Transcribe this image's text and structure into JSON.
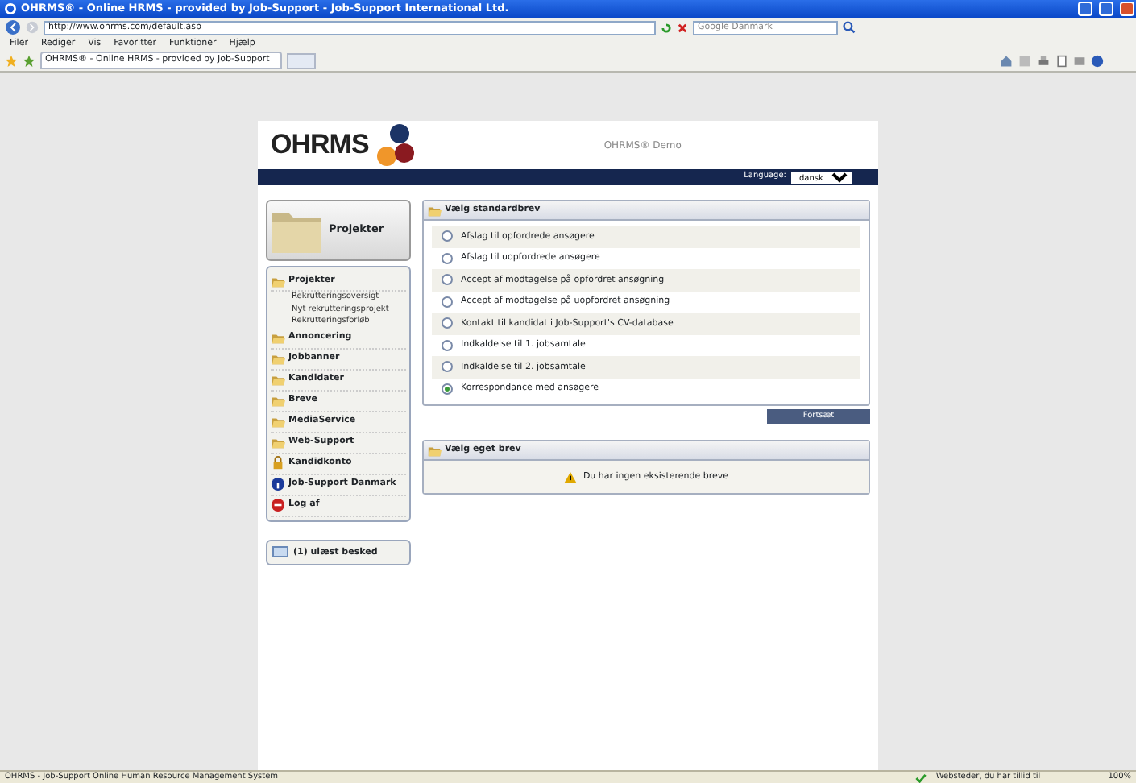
{
  "window": {
    "title": "OHRMS® - Online HRMS - provided by Job-Support - Job-Support International Ltd."
  },
  "browser": {
    "address": "http://www.ohrms.com/default.asp",
    "search_placeholder": "Google Danmark",
    "menu": [
      "Filer",
      "Rediger",
      "Vis",
      "Favoritter",
      "Funktioner",
      "Hjælp"
    ],
    "tab": "OHRMS® - Online HRMS - provided by Job-Support"
  },
  "header": {
    "logo": "OHRMS",
    "title": "OHRMS® Demo",
    "language_label": "Language:",
    "language_value": "dansk"
  },
  "sidebar": {
    "big_button": "Projekter",
    "items": [
      {
        "label": "Projekter",
        "kind": "folder",
        "children": [
          {
            "label": "Rekrutteringsoversigt"
          },
          {
            "label": "Nyt rekrutteringsprojekt"
          },
          {
            "label": "Rekrutteringsforløb"
          }
        ]
      },
      {
        "label": "Annoncering",
        "kind": "folder"
      },
      {
        "label": "Jobbanner",
        "kind": "folder"
      },
      {
        "label": "Kandidater",
        "kind": "folder"
      },
      {
        "label": "Breve",
        "kind": "folder"
      },
      {
        "label": "MediaService",
        "kind": "folder"
      },
      {
        "label": "Web-Support",
        "kind": "folder"
      },
      {
        "label": "Kandidkonto",
        "kind": "lock"
      },
      {
        "label": "Job-Support Danmark",
        "kind": "info"
      },
      {
        "label": "Log af",
        "kind": "stop"
      }
    ],
    "message": "(1) ulæst besked"
  },
  "standard_letters": {
    "title": "Vælg standardbrev",
    "options": [
      {
        "label": "Afslag til opfordrede ansøgere",
        "selected": false
      },
      {
        "label": "Afslag til uopfordrede ansøgere",
        "selected": false
      },
      {
        "label": "Accept af modtagelse på opfordret ansøgning",
        "selected": false
      },
      {
        "label": "Accept af modtagelse på uopfordret ansøgning",
        "selected": false
      },
      {
        "label": "Kontakt til kandidat i Job-Support's CV-database",
        "selected": false
      },
      {
        "label": "Indkaldelse til 1. jobsamtale",
        "selected": false
      },
      {
        "label": "Indkaldelse til 2. jobsamtale",
        "selected": false
      },
      {
        "label": "Korrespondance med ansøgere",
        "selected": true
      }
    ],
    "button": "Fortsæt"
  },
  "own_letters": {
    "title": "Vælg eget brev",
    "message": "Du har ingen eksisterende breve"
  },
  "status_bar": {
    "text": "OHRMS - Job-Support Online Human Resource Management System",
    "zone": "Websteder, du har tillid til",
    "zoom": "100%"
  }
}
